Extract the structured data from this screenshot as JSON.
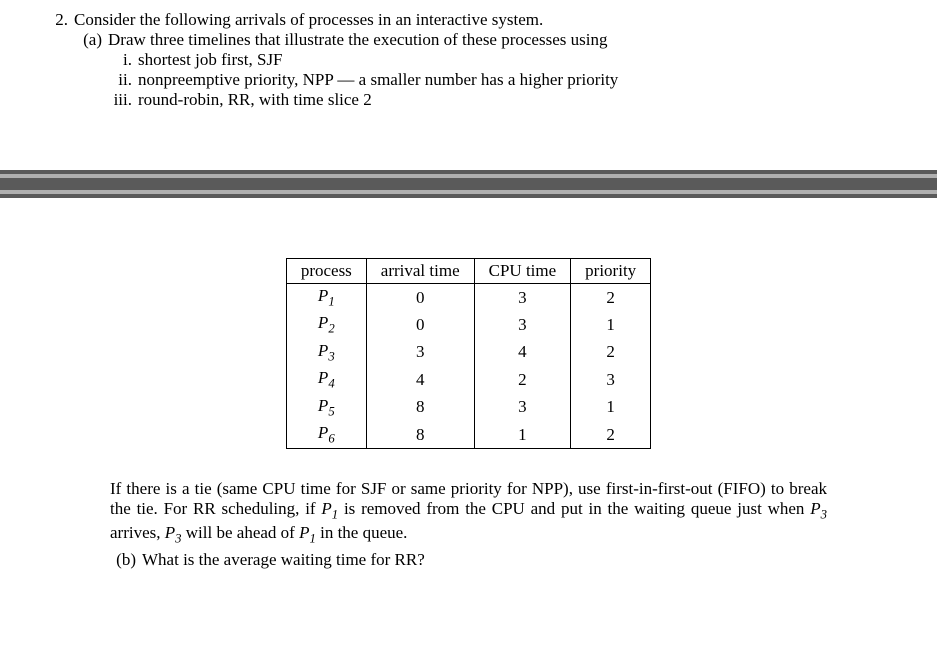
{
  "problem": {
    "number": "2.",
    "stem": "Consider the following arrivals of processes in an interactive system.",
    "part_a": {
      "label": "(a)",
      "text": "Draw three timelines that illustrate the execution of these processes using",
      "items": [
        {
          "num": "i.",
          "text": "shortest job first, SJF"
        },
        {
          "num": "ii.",
          "text": "nonpreemptive priority, NPP — a smaller number has a higher priority"
        },
        {
          "num": "iii.",
          "text": "round-robin, RR, with time slice 2"
        }
      ]
    },
    "table": {
      "headers": [
        "process",
        "arrival time",
        "CPU time",
        "priority"
      ],
      "rows": [
        {
          "proc_base": "P",
          "proc_sub": "1",
          "arrival": "0",
          "cpu": "3",
          "pri": "2"
        },
        {
          "proc_base": "P",
          "proc_sub": "2",
          "arrival": "0",
          "cpu": "3",
          "pri": "1"
        },
        {
          "proc_base": "P",
          "proc_sub": "3",
          "arrival": "3",
          "cpu": "4",
          "pri": "2"
        },
        {
          "proc_base": "P",
          "proc_sub": "4",
          "arrival": "4",
          "cpu": "2",
          "pri": "3"
        },
        {
          "proc_base": "P",
          "proc_sub": "5",
          "arrival": "8",
          "cpu": "3",
          "pri": "1"
        },
        {
          "proc_base": "P",
          "proc_sub": "6",
          "arrival": "8",
          "cpu": "1",
          "pri": "2"
        }
      ]
    },
    "tie_note_1": "If there is a tie (same CPU time for SJF or same priority for NPP), use first-in-first-out (FIFO) to break the tie. For RR scheduling, if ",
    "tie_p1_base": "P",
    "tie_p1_sub": "1",
    "tie_note_2": " is removed from the CPU and put in the waiting queue just when ",
    "tie_p3_base": "P",
    "tie_p3_sub": "3",
    "tie_note_3": " arrives, ",
    "tie_note_4": " will be ahead of ",
    "tie_note_5": " in the queue.",
    "part_b": {
      "label": "(b)",
      "text": "What is the average waiting time for RR?"
    }
  }
}
